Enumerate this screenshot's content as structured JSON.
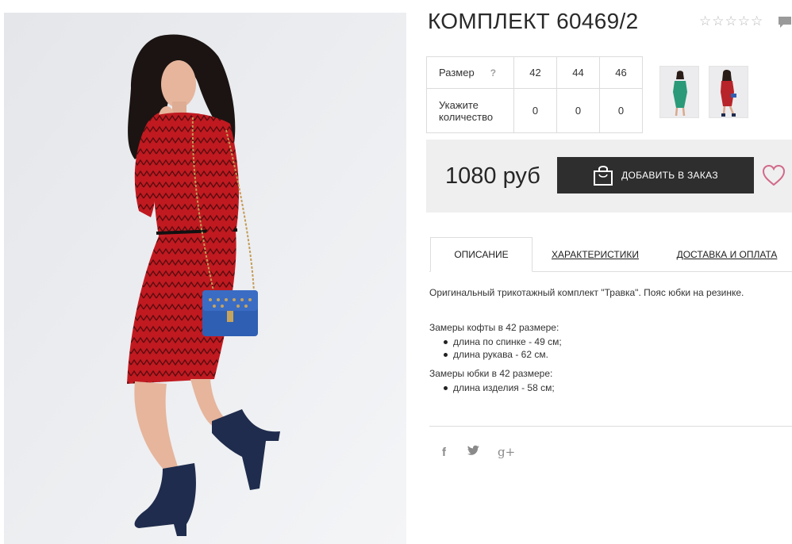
{
  "product": {
    "title": "КОМПЛЕКТ 60469/2",
    "rating": {
      "stars": 5,
      "filled": 0
    }
  },
  "size_table": {
    "size_label": "Размер",
    "help_label": "?",
    "sizes": [
      "42",
      "44",
      "46"
    ],
    "qty_label_line1": "Укажите",
    "qty_label_line2": "количество",
    "quantities": [
      "0",
      "0",
      "0"
    ]
  },
  "thumbnails": [
    {
      "name": "green-dress-thumbnail",
      "dress_color": "#2a9a78"
    },
    {
      "name": "red-dress-thumbnail",
      "dress_color": "#b7242a"
    }
  ],
  "purchase": {
    "price": "1080 руб",
    "add_to_order_label": "ДОБАВИТЬ В ЗАКАЗ",
    "wishlist_icon": "heart-icon",
    "cart_icon": "shopping-bag-icon"
  },
  "tabs": [
    {
      "label": "ОПИСАНИЕ",
      "active": true
    },
    {
      "label": "ХАРАКТЕРИСТИКИ",
      "active": false
    },
    {
      "label": "ДОСТАВКА И ОПЛАТА",
      "active": false
    }
  ],
  "description": {
    "intro": "Оригинальный трикотажный комплект \"Травка\". Пояс юбки на резинке.",
    "jacket_heading": "Замеры кофты в 42 размере:",
    "jacket_items": [
      "длина по спинке - 49 см;",
      "длина рукава - 62 см."
    ],
    "skirt_heading": "Замеры юбки в 42 размере:",
    "skirt_items": [
      "длина изделия - 58 см;"
    ]
  },
  "social": {
    "facebook": "f",
    "twitter": "🐦",
    "google_plus": "g+"
  },
  "colors": {
    "accent_dark": "#2e2e2e",
    "price_bg": "#efefef",
    "heart": "#d26a8a",
    "dress_red": "#b3171d",
    "boots_navy": "#1f2c4d",
    "bag_blue": "#2f5fb3"
  }
}
